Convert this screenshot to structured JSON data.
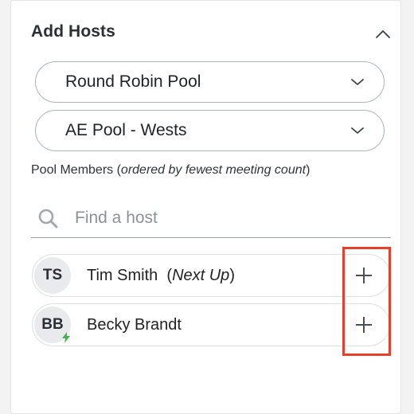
{
  "panel": {
    "title": "Add Hosts"
  },
  "pool_select": {
    "value": "Round Robin Pool"
  },
  "subpool_select": {
    "value": "AE Pool - Wests"
  },
  "members": {
    "label_prefix": "Pool Members (",
    "label_italic": "ordered by fewest meeting count",
    "label_suffix": ")"
  },
  "search": {
    "placeholder": "Find a host",
    "value": ""
  },
  "hosts": [
    {
      "initials": "TS",
      "name": "Tim Smith",
      "note_open": "(",
      "note": "Next Up",
      "note_close": ")"
    },
    {
      "initials": "BB",
      "name": "Becky Brandt",
      "badge_icon": "lightning-bolt-icon"
    }
  ],
  "colors": {
    "highlight": "#e4402b",
    "bolt": "#4caf50"
  }
}
